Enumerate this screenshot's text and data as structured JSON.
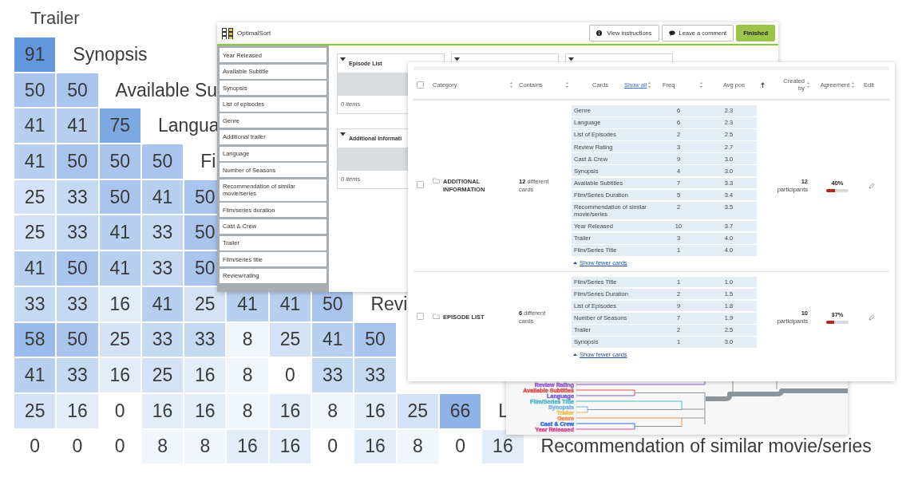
{
  "matrix": {
    "header": "Trailer",
    "rows": [
      {
        "cells": [
          "91"
        ],
        "label": "Synopsis"
      },
      {
        "cells": [
          "50",
          "50"
        ],
        "label": "Available Su"
      },
      {
        "cells": [
          "41",
          "41",
          "75"
        ],
        "label": "Langua"
      },
      {
        "cells": [
          "41",
          "50",
          "50",
          "50"
        ],
        "label": "Fi"
      },
      {
        "cells": [
          "25",
          "33",
          "50",
          "41",
          "50"
        ]
      },
      {
        "cells": [
          "25",
          "33",
          "41",
          "33",
          "50"
        ]
      },
      {
        "cells": [
          "41",
          "50",
          "41",
          "33",
          "50"
        ]
      },
      {
        "cells": [
          "33",
          "33",
          "16",
          "41",
          "25",
          "41",
          "41",
          "50"
        ],
        "label": "Revi"
      },
      {
        "cells": [
          "58",
          "50",
          "25",
          "33",
          "33",
          "8",
          "25",
          "41",
          "50"
        ]
      },
      {
        "cells": [
          "41",
          "33",
          "16",
          "25",
          "16",
          "8",
          "0",
          "33",
          "33"
        ]
      },
      {
        "cells": [
          "25",
          "16",
          "0",
          "16",
          "16",
          "8",
          "16",
          "8",
          "16",
          "25",
          "66"
        ],
        "label": "L"
      },
      {
        "cells": [
          "0",
          "0",
          "0",
          "8",
          "8",
          "16",
          "16",
          "0",
          "16",
          "8",
          "0",
          "16"
        ],
        "label": "Recommendation of similar movie/series"
      }
    ]
  },
  "sort_window": {
    "title": "OptimalSort",
    "buttons": [
      {
        "label": "View instructions",
        "kind": "info"
      },
      {
        "label": "Leave a comment",
        "kind": "comment"
      },
      {
        "label": "Finished",
        "kind": "primary"
      }
    ],
    "cards": [
      "Year Released",
      "Available Subtitle",
      "Synopsis",
      "List of episodes",
      "Genre",
      "Additional trailer",
      "Language",
      "Number of Seasons",
      "Recommendation of similar movie/series",
      "Film/series duration",
      "Cast & Crew",
      "Trailer",
      "Film/series title",
      "Review/rating"
    ],
    "categories": [
      {
        "title": "Episode List",
        "count": "0 items"
      },
      {
        "title": "Additional Informati",
        "count": "0 items"
      }
    ]
  },
  "results_table": {
    "all_checked": false,
    "columns": [
      {
        "label": "Category",
        "sortable": true,
        "ascending": false
      },
      {
        "label": "Contains",
        "sortable": true,
        "ascending": false
      },
      {
        "label": "Cards",
        "link": "Show all",
        "sortable": true,
        "ascending": false
      },
      {
        "label": "Freq",
        "sortable": true,
        "ascending": false
      },
      {
        "label": "Avg pos",
        "sortable": true,
        "ascending": true
      },
      {
        "label": "Created by",
        "sortable": true,
        "ascending": false
      },
      {
        "label": "Agreement",
        "sortable": true,
        "ascending": false
      },
      {
        "label": "Edit",
        "sortable": false
      }
    ],
    "rows": [
      {
        "checked": false,
        "category": "ADDITIONAL INFORMATION",
        "contains": "**12** different cards",
        "cards": [
          {
            "name": "Genre",
            "freq": "6",
            "avg": "2.3"
          },
          {
            "name": "Language",
            "freq": "6",
            "avg": "2.3"
          },
          {
            "name": "List of Episodes",
            "freq": "2",
            "avg": "2.5"
          },
          {
            "name": "Review Rating",
            "freq": "3",
            "avg": "2.7"
          },
          {
            "name": "Cast & Crew",
            "freq": "9",
            "avg": "3.0"
          },
          {
            "name": "Synopsis",
            "freq": "4",
            "avg": "3.0"
          },
          {
            "name": "Available Subtitles",
            "freq": "7",
            "avg": "3.3"
          },
          {
            "name": "Film/Series Duration",
            "freq": "5",
            "avg": "3.4"
          },
          {
            "name": "Recommendation of similar movie/series",
            "freq": "2",
            "avg": "3.5"
          },
          {
            "name": "Year Released",
            "freq": "10",
            "avg": "3.7"
          },
          {
            "name": "Trailer",
            "freq": "3",
            "avg": "4.0"
          },
          {
            "name": "Film/Series Title",
            "freq": "1",
            "avg": "4.0"
          }
        ],
        "toggle": "Show fewer cards",
        "participants": "12",
        "participants_label": "participants",
        "agreement": "40%",
        "level": 0.4
      },
      {
        "checked": false,
        "category": "EPISODE LIST",
        "contains": "**6** different cards",
        "cards": [
          {
            "name": "Film/Series Title",
            "freq": "1",
            "avg": "1.0"
          },
          {
            "name": "Film/Series Duration",
            "freq": "2",
            "avg": "1.5"
          },
          {
            "name": "List of Episodes",
            "freq": "9",
            "avg": "1.8"
          },
          {
            "name": "Number of Seasons",
            "freq": "7",
            "avg": "1.9"
          },
          {
            "name": "Trailer",
            "freq": "2",
            "avg": "2.5"
          },
          {
            "name": "Synopsis",
            "freq": "1",
            "avg": "3.0"
          }
        ],
        "toggle": "Show fewer cards",
        "participants": "10",
        "participants_label": "participants",
        "agreement": "37%",
        "level": 0.37
      }
    ]
  },
  "dendrogram": {
    "labels": [
      {
        "text": "Review Rating",
        "color": "#9b5fd0"
      },
      {
        "text": "Available Subtitles",
        "color": "#d9534f"
      },
      {
        "text": "Language",
        "color": "#7b61d9"
      },
      {
        "text": "Film/Series Title",
        "color": "#4fb8c0"
      },
      {
        "text": "Synopsis",
        "color": "#7fb3e8"
      },
      {
        "text": "Trailer",
        "color": "#e8c14f"
      },
      {
        "text": "Genre",
        "color": "#f0904f"
      },
      {
        "text": "Cast & Crew",
        "color": "#3b6fd9"
      },
      {
        "text": "Year Released",
        "color": "#d9488f"
      }
    ]
  }
}
